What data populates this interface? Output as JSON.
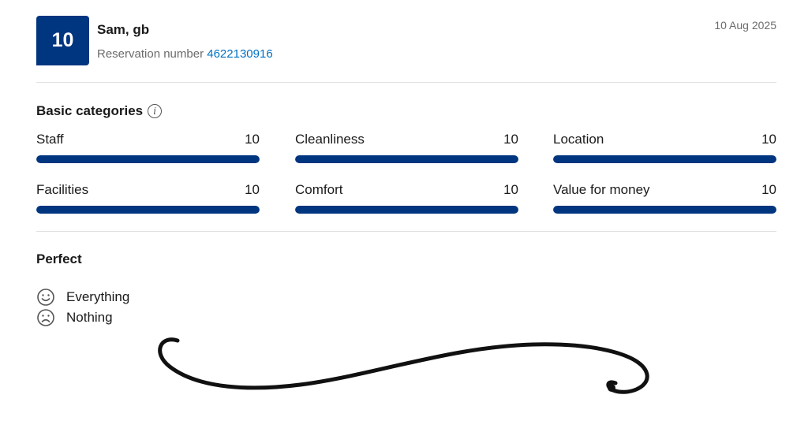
{
  "review": {
    "score": "10",
    "reviewer_name": "Sam, gb",
    "reservation_label": "Reservation number",
    "reservation_number": "4622130916",
    "date": "10 Aug 2025"
  },
  "categories_section": {
    "title": "Basic categories",
    "info_icon": "info-icon",
    "items": [
      {
        "label": "Staff",
        "score": "10",
        "fill_fraction": 1.0
      },
      {
        "label": "Cleanliness",
        "score": "10",
        "fill_fraction": 1.0
      },
      {
        "label": "Location",
        "score": "10",
        "fill_fraction": 1.0
      },
      {
        "label": "Facilities",
        "score": "10",
        "fill_fraction": 1.0
      },
      {
        "label": "Comfort",
        "score": "10",
        "fill_fraction": 1.0
      },
      {
        "label": "Value for money",
        "score": "10",
        "fill_fraction": 1.0
      }
    ]
  },
  "feedback": {
    "title": "Perfect",
    "positive": {
      "icon": "smile-icon",
      "text": "Everything"
    },
    "negative": {
      "icon": "frown-icon",
      "text": "Nothing"
    }
  },
  "colors": {
    "brand_blue": "#003580",
    "link_blue": "#0071c2"
  }
}
